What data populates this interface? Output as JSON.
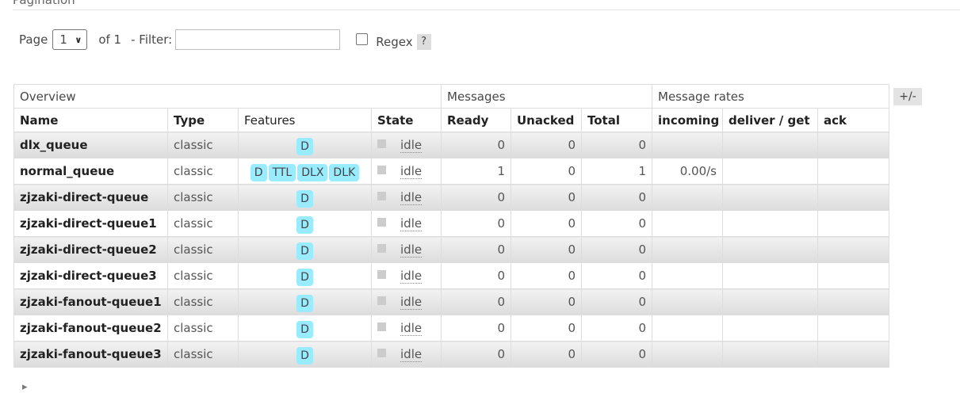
{
  "section_title": "Pagination",
  "pager": {
    "page_label": "Page",
    "page_value": "1",
    "of_label": "of 1",
    "filter_label": "- Filter:",
    "filter_value": "",
    "regex_label": "Regex",
    "regex_checked": false,
    "help_label": "?"
  },
  "toggle_columns_label": "+/-",
  "table": {
    "groups": {
      "overview": "Overview",
      "messages": "Messages",
      "message_rates": "Message rates"
    },
    "columns": {
      "name": "Name",
      "type": "Type",
      "features": "Features",
      "state": "State",
      "ready": "Ready",
      "unacked": "Unacked",
      "total": "Total",
      "incoming": "incoming",
      "deliver_get": "deliver / get",
      "ack": "ack"
    },
    "rows": [
      {
        "name": "dlx_queue",
        "type": "classic",
        "features": [
          "D"
        ],
        "state": "idle",
        "ready": "0",
        "unacked": "0",
        "total": "0",
        "incoming": "",
        "deliver_get": "",
        "ack": ""
      },
      {
        "name": "normal_queue",
        "type": "classic",
        "features": [
          "D",
          "TTL",
          "DLX",
          "DLK"
        ],
        "state": "idle",
        "ready": "1",
        "unacked": "0",
        "total": "1",
        "incoming": "0.00/s",
        "deliver_get": "",
        "ack": ""
      },
      {
        "name": "zjzaki-direct-queue",
        "type": "classic",
        "features": [
          "D"
        ],
        "state": "idle",
        "ready": "0",
        "unacked": "0",
        "total": "0",
        "incoming": "",
        "deliver_get": "",
        "ack": ""
      },
      {
        "name": "zjzaki-direct-queue1",
        "type": "classic",
        "features": [
          "D"
        ],
        "state": "idle",
        "ready": "0",
        "unacked": "0",
        "total": "0",
        "incoming": "",
        "deliver_get": "",
        "ack": ""
      },
      {
        "name": "zjzaki-direct-queue2",
        "type": "classic",
        "features": [
          "D"
        ],
        "state": "idle",
        "ready": "0",
        "unacked": "0",
        "total": "0",
        "incoming": "",
        "deliver_get": "",
        "ack": ""
      },
      {
        "name": "zjzaki-direct-queue3",
        "type": "classic",
        "features": [
          "D"
        ],
        "state": "idle",
        "ready": "0",
        "unacked": "0",
        "total": "0",
        "incoming": "",
        "deliver_get": "",
        "ack": ""
      },
      {
        "name": "zjzaki-fanout-queue1",
        "type": "classic",
        "features": [
          "D"
        ],
        "state": "idle",
        "ready": "0",
        "unacked": "0",
        "total": "0",
        "incoming": "",
        "deliver_get": "",
        "ack": ""
      },
      {
        "name": "zjzaki-fanout-queue2",
        "type": "classic",
        "features": [
          "D"
        ],
        "state": "idle",
        "ready": "0",
        "unacked": "0",
        "total": "0",
        "incoming": "",
        "deliver_get": "",
        "ack": ""
      },
      {
        "name": "zjzaki-fanout-queue3",
        "type": "classic",
        "features": [
          "D"
        ],
        "state": "idle",
        "ready": "0",
        "unacked": "0",
        "total": "0",
        "incoming": "",
        "deliver_get": "",
        "ack": ""
      }
    ]
  },
  "colors": {
    "feature_badge": "#99ebff",
    "state_indicator": "#cccccc"
  },
  "icons": {
    "page_dropdown": "chevron-down-icon",
    "expand_section": "triangle-right-icon"
  }
}
